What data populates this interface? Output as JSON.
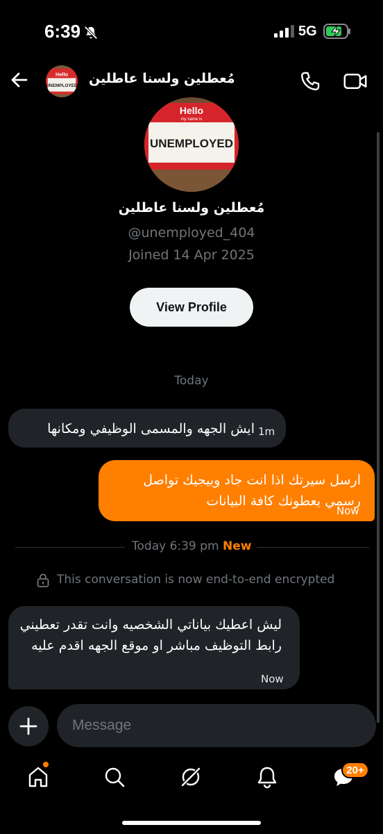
{
  "status_bar": {
    "time": "6:39",
    "network": "5G"
  },
  "header": {
    "title": "مُعطلين ولسنا عاطلين"
  },
  "avatar_art": {
    "hello": "Hello",
    "my_name_is": "my name is",
    "name": "UNEMPLOYED"
  },
  "profile": {
    "name": "مُعطلين ولسنا عاطلين",
    "handle": "@unemployed_404",
    "joined": "Joined 14 Apr 2025",
    "view_button": "View Profile"
  },
  "day_label": "Today",
  "messages": [
    {
      "text": "ايش الجهه والمسمى الوظيفي ومكانها",
      "time": "1m"
    },
    {
      "text": "ارسل سيرتك اذا انت جاد وبيجيك تواصل رسمي يعطونك كافة البيانات",
      "time": "Now"
    },
    {
      "text": "ليش اعطيك بياناتي الشخصيه وانت تقدر تعطيني رابط التوظيف مباشر او موقع الجهه اقدم عليه",
      "time": "Now"
    }
  ],
  "new_divider": {
    "datetime": "Today 6:39 pm",
    "new_label": "New"
  },
  "encryption_notice": "This conversation is now end-to-end encrypted",
  "composer": {
    "placeholder": "Message"
  },
  "nav": {
    "messages_badge": "20+"
  },
  "colors": {
    "accent": "#ff7f00",
    "background": "#000000",
    "incoming_bubble": "#202327",
    "muted": "#71767b"
  }
}
